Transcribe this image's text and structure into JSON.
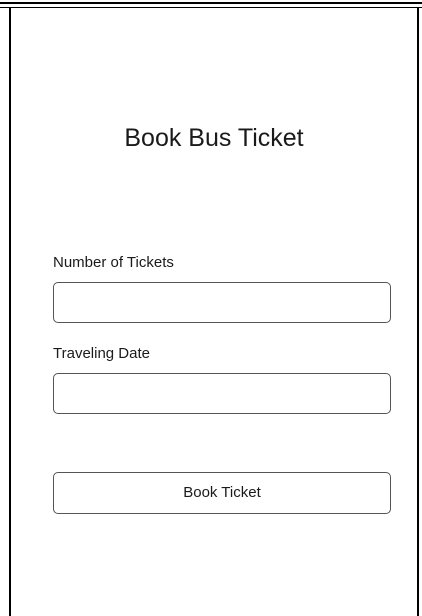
{
  "page": {
    "title": "Book Bus Ticket"
  },
  "form": {
    "tickets": {
      "label": "Number of Tickets",
      "value": "",
      "placeholder": ""
    },
    "date": {
      "label": "Traveling Date",
      "value": "",
      "placeholder": ""
    },
    "submit_label": "Book Ticket"
  }
}
